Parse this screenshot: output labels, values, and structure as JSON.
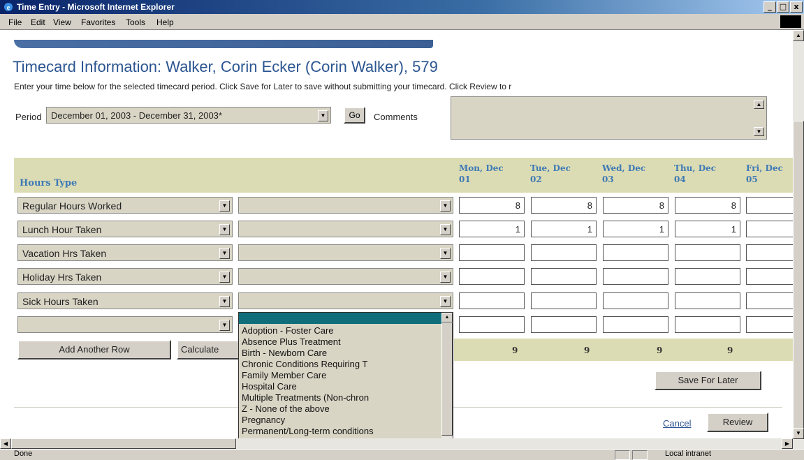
{
  "window": {
    "title": "Time Entry - Microsoft Internet Explorer",
    "minimize": "_",
    "maximize": "□",
    "close": "x"
  },
  "menubar": [
    "File",
    "Edit",
    "View",
    "Favorites",
    "Tools",
    "Help"
  ],
  "page": {
    "title": "Timecard Information: Walker, Corin Ecker (Corin Walker), 579",
    "instructions": "Enter your time below for the selected timecard period. Click Save for Later to save without submitting your timecard. Click Review to r"
  },
  "period": {
    "label": "Period",
    "value": "December 01, 2003 - December 31, 2003*",
    "go_label": "Go"
  },
  "comments": {
    "label": "Comments",
    "value": ""
  },
  "table": {
    "hours_type_header": "Hours Type",
    "days": [
      {
        "line1": "Mon, Dec",
        "line2": "01"
      },
      {
        "line1": "Tue, Dec",
        "line2": "02"
      },
      {
        "line1": "Wed, Dec",
        "line2": "03"
      },
      {
        "line1": "Thu, Dec",
        "line2": "04"
      },
      {
        "line1": "Fri, Dec",
        "line2": "05"
      }
    ],
    "rows": [
      {
        "type": "Regular Hours Worked",
        "hours": [
          "8",
          "8",
          "8",
          "8",
          ""
        ]
      },
      {
        "type": "Lunch Hour Taken",
        "hours": [
          "1",
          "1",
          "1",
          "1",
          ""
        ]
      },
      {
        "type": "Vacation Hrs Taken",
        "hours": [
          "",
          "",
          "",
          "",
          ""
        ]
      },
      {
        "type": "Holiday Hrs Taken",
        "hours": [
          "",
          "",
          "",
          "",
          ""
        ]
      },
      {
        "type": "Sick Hours Taken",
        "hours": [
          "",
          "",
          "",
          "",
          ""
        ]
      },
      {
        "type": "",
        "hours": [
          "",
          "",
          "",
          "",
          ""
        ]
      }
    ],
    "totals": [
      "9",
      "9",
      "9",
      "9"
    ]
  },
  "buttons": {
    "add_row": "Add Another Row",
    "calculate": "Calculate",
    "save_later": "Save For Later",
    "review": "Review",
    "cancel": "Cancel"
  },
  "dropdown_options": [
    "",
    "Adoption - Foster Care",
    "Absence Plus Treatment",
    "Birth - Newborn Care",
    "Chronic Conditions Requiring T",
    "Family Member Care",
    "Hospital Care",
    "Multiple Treatments (Non-chron",
    "Z - None of the above",
    "Pregnancy",
    "Permanent/Long-term conditions"
  ],
  "status": {
    "text": "Done",
    "zone": "Local intranet"
  }
}
